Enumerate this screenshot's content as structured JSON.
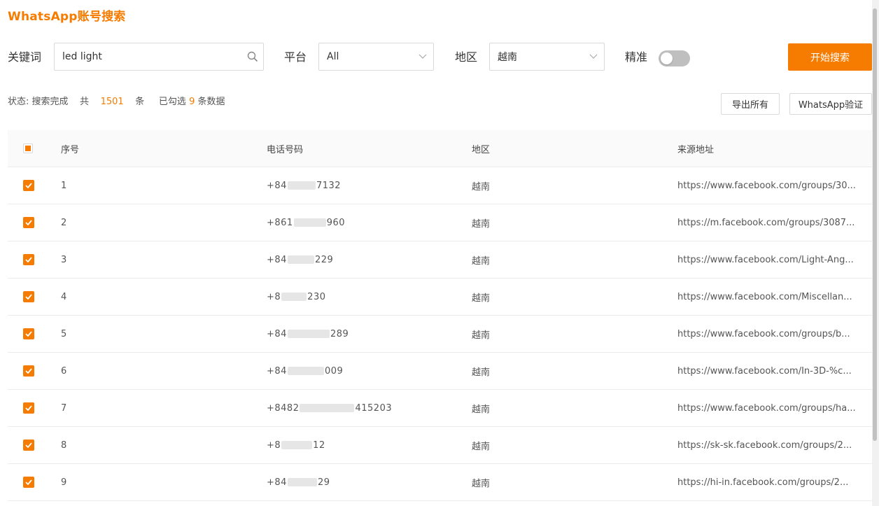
{
  "app": {
    "title": "WhatsApp账号搜索"
  },
  "search": {
    "keyword_label": "关键词",
    "keyword_value": "led light",
    "platform_label": "平台",
    "platform_value": "All",
    "region_label": "地区",
    "region_value": "越南",
    "exact_label": "精准",
    "exact_enabled": false,
    "start_button": "开始搜索"
  },
  "status": {
    "prefix": "状态: 搜索完成",
    "total_prefix": "共",
    "total": "1501",
    "total_suffix": "条",
    "selected_prefix": "已勾选",
    "selected": "9",
    "selected_suffix": "条数据"
  },
  "actions": {
    "export_all": "导出所有",
    "whatsapp_verify": "WhatsApp验证"
  },
  "colors": {
    "accent": "#f57c00",
    "border": "#d9d9d9"
  },
  "table": {
    "headers": {
      "index": "序号",
      "phone": "电话号码",
      "region": "地区",
      "source": "来源地址"
    },
    "rows": [
      {
        "index": "1",
        "phone_prefix": "+84",
        "phone_suffix": "7132",
        "region": "越南",
        "source": "https://www.facebook.com/groups/30..."
      },
      {
        "index": "2",
        "phone_prefix": "+861",
        "phone_suffix": "960",
        "region": "越南",
        "source": "https://m.facebook.com/groups/3087..."
      },
      {
        "index": "3",
        "phone_prefix": "+84",
        "phone_suffix": "229",
        "region": "越南",
        "source": "https://www.facebook.com/Light-Ang..."
      },
      {
        "index": "4",
        "phone_prefix": "+8",
        "phone_suffix": "230",
        "region": "越南",
        "source": "https://www.facebook.com/Miscellan..."
      },
      {
        "index": "5",
        "phone_prefix": "+84",
        "phone_suffix": "289",
        "region": "越南",
        "source": "https://www.facebook.com/groups/b..."
      },
      {
        "index": "6",
        "phone_prefix": "+84",
        "phone_suffix": "009",
        "region": "越南",
        "source": "https://www.facebook.com/In-3D-%c..."
      },
      {
        "index": "7",
        "phone_prefix": "+8482",
        "phone_suffix": "415203",
        "region": "越南",
        "source": "https://www.facebook.com/groups/ha..."
      },
      {
        "index": "8",
        "phone_prefix": "+8",
        "phone_suffix": "12",
        "region": "越南",
        "source": "https://sk-sk.facebook.com/groups/2..."
      },
      {
        "index": "9",
        "phone_prefix": "+84",
        "phone_suffix": "29",
        "region": "越南",
        "source": "https://hi-in.facebook.com/groups/2..."
      }
    ]
  }
}
